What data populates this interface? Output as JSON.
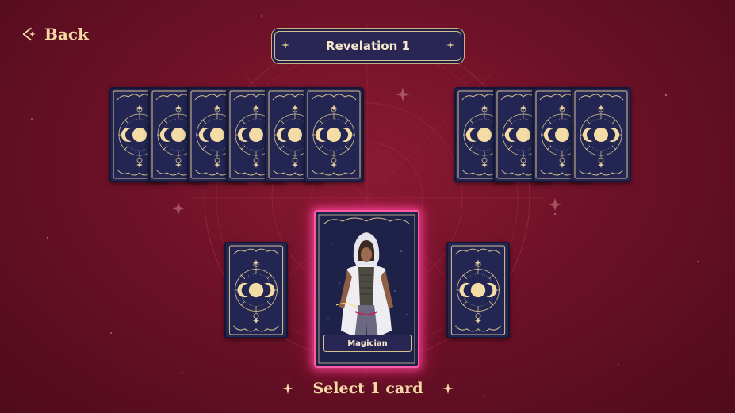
{
  "header": {
    "back_label": "Back",
    "title": "Revelation 1"
  },
  "card_backs": {
    "left_group_count": 6,
    "right_group_count": 4,
    "bottom_side_count": 2
  },
  "selected_card": {
    "name": "Magician"
  },
  "footer": {
    "prompt": "Select 1 card"
  },
  "colors": {
    "background": "#6e1128",
    "gold_text": "#f2d9a6",
    "card_back": "#232652",
    "card_ornament": "#d8c08e",
    "selection_glow": "#ff5aa8"
  },
  "icons": {
    "back": "arrow-back-sparkle-icon",
    "sparkle": "four-point-star-icon",
    "card_back_art": "moon-phases-sun-icon"
  }
}
